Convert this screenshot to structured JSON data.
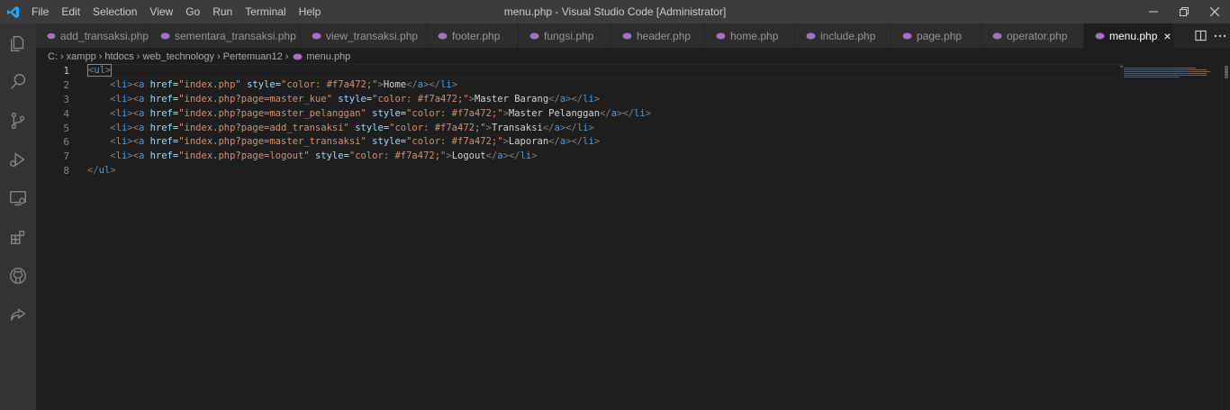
{
  "titlebar": {
    "title": "menu.php - Visual Studio Code [Administrator]",
    "menu": [
      "File",
      "Edit",
      "Selection",
      "View",
      "Go",
      "Run",
      "Terminal",
      "Help"
    ]
  },
  "tabs": [
    {
      "label": "add_transaksi.php",
      "active": false
    },
    {
      "label": "sementara_transaksi.php",
      "active": false
    },
    {
      "label": "view_transaksi.php",
      "active": false
    },
    {
      "label": "footer.php",
      "active": false
    },
    {
      "label": "fungsi.php",
      "active": false
    },
    {
      "label": "header.php",
      "active": false
    },
    {
      "label": "home.php",
      "active": false
    },
    {
      "label": "include.php",
      "active": false
    },
    {
      "label": "page.php",
      "active": false
    },
    {
      "label": "operator.php",
      "active": false
    },
    {
      "label": "menu.php",
      "active": true
    }
  ],
  "tab_close_glyph": "×",
  "breadcrumb": [
    "C:",
    "xampp",
    "htdocs",
    "web_technology",
    "Pertemuan12",
    "menu.php"
  ],
  "editor": {
    "line_numbers": [
      "1",
      "2",
      "3",
      "4",
      "5",
      "6",
      "7",
      "8"
    ],
    "current_line": 1,
    "lines": [
      "<ul>",
      "    <li><a href=\"index.php\" style=\"color: #f7a472;\">Home</a></li>",
      "    <li><a href=\"index.php?page=master_kue\" style=\"color: #f7a472;\">Master Barang</a></li>",
      "    <li><a href=\"index.php?page=master_pelanggan\" style=\"color: #f7a472;\">Master Pelanggan</a></li>",
      "    <li><a href=\"index.php?page=add_transaksi\" style=\"color: #f7a472;\">Transaksi</a></li>",
      "    <li><a href=\"index.php?page=master_transaksi\" style=\"color: #f7a472;\">Laporan</a></li>",
      "    <li><a href=\"index.php?page=logout\" style=\"color: #f7a472;\">Logout</a></li>",
      "</ul>"
    ]
  },
  "colors": {
    "accent": "#007acc",
    "php_icon": "#a074c4"
  },
  "activity_icons": [
    "explorer-icon",
    "search-icon",
    "source-control-icon",
    "run-debug-icon",
    "remote-explorer-icon",
    "extensions-icon",
    "github-icon",
    "live-share-icon"
  ]
}
